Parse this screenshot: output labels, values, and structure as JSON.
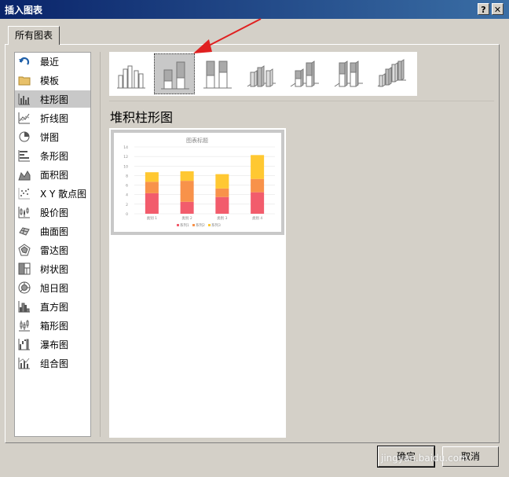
{
  "window": {
    "title": "插入图表",
    "help_label": "?",
    "close_label": "✕"
  },
  "tab": {
    "label": "所有图表"
  },
  "sidebar": {
    "items": [
      {
        "label": "最近",
        "icon": "undo-arrow-icon"
      },
      {
        "label": "模板",
        "icon": "folder-icon"
      },
      {
        "label": "柱形图",
        "icon": "column-chart-icon",
        "active": true
      },
      {
        "label": "折线图",
        "icon": "line-chart-icon"
      },
      {
        "label": "饼图",
        "icon": "pie-chart-icon"
      },
      {
        "label": "条形图",
        "icon": "bar-chart-icon"
      },
      {
        "label": "面积图",
        "icon": "area-chart-icon"
      },
      {
        "label": "X Y 散点图",
        "icon": "scatter-chart-icon"
      },
      {
        "label": "股价图",
        "icon": "stock-chart-icon"
      },
      {
        "label": "曲面图",
        "icon": "surface-chart-icon"
      },
      {
        "label": "雷达图",
        "icon": "radar-chart-icon"
      },
      {
        "label": "树状图",
        "icon": "treemap-chart-icon"
      },
      {
        "label": "旭日图",
        "icon": "sunburst-chart-icon"
      },
      {
        "label": "直方图",
        "icon": "histogram-chart-icon"
      },
      {
        "label": "箱形图",
        "icon": "box-whisker-chart-icon"
      },
      {
        "label": "瀑布图",
        "icon": "waterfall-chart-icon"
      },
      {
        "label": "组合图",
        "icon": "combo-chart-icon"
      }
    ]
  },
  "subtypes": [
    {
      "icon": "clustered-column-icon"
    },
    {
      "icon": "stacked-column-icon",
      "selected": true
    },
    {
      "icon": "100-stacked-column-icon"
    },
    {
      "icon": "3d-clustered-column-icon"
    },
    {
      "icon": "3d-stacked-column-icon"
    },
    {
      "icon": "3d-100-stacked-column-icon"
    },
    {
      "icon": "3d-column-icon"
    }
  ],
  "annotation": {
    "color": "#e02020"
  },
  "main": {
    "heading": "堆积柱形图"
  },
  "chart_data": {
    "type": "bar",
    "stacked": true,
    "title": "图表标题",
    "categories": [
      "类别 1",
      "类别 2",
      "类别 3",
      "类别 4"
    ],
    "series": [
      {
        "name": "系列1",
        "values": [
          4.3,
          2.5,
          3.5,
          4.5
        ],
        "color": "#f25c6c"
      },
      {
        "name": "系列2",
        "values": [
          2.4,
          4.4,
          1.8,
          2.8
        ],
        "color": "#f8924a"
      },
      {
        "name": "系列3",
        "values": [
          2,
          2,
          3,
          5
        ],
        "color": "#ffc832"
      }
    ],
    "yticks": [
      "0",
      "2",
      "4",
      "6",
      "8",
      "10",
      "12",
      "14"
    ],
    "ylim": [
      0,
      14
    ],
    "grid": true,
    "legend_position": "bottom"
  },
  "buttons": {
    "ok": "确定",
    "cancel": "取消"
  },
  "watermark": "jingyan.baidu.com"
}
